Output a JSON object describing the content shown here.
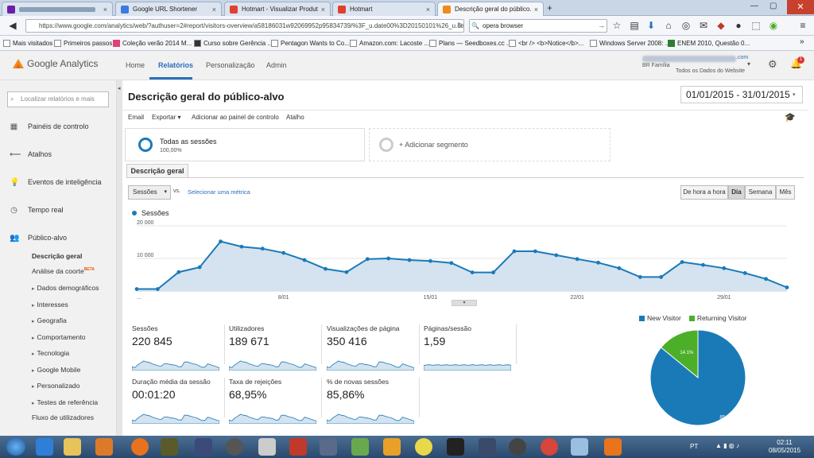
{
  "browser": {
    "tabs": [
      {
        "label": "",
        "fav_color": "#6b1fa8",
        "active": false
      },
      {
        "label": "Google URL Shortener",
        "fav_color": "#3b7be0",
        "active": false
      },
      {
        "label": "Hotmart - Visualizar Produto",
        "fav_color": "#e0402d",
        "active": false
      },
      {
        "label": "Hotmart",
        "fav_color": "#e0402d",
        "active": false
      },
      {
        "label": "Descrição geral do público...",
        "fav_color": "#f08a1d",
        "active": true
      }
    ],
    "url": "https://www.google.com/analytics/web/?authuser=2#report/visitors-overview/a58186031w92069952p95834739/%3F_u.date00%3D20150101%26_u.date01%",
    "search": "opera browser",
    "bookmarks": [
      "Mais visitados",
      "Primeiros passos",
      "Coleção verão 2014 M...",
      "Curso sobre Gerência ...",
      "Pentagon Wants to Co...",
      "Amazon.com: Lacoste ...",
      "Plans — Seedboxes.cc ...",
      "<br /> <b>Notice</b>...",
      "Windows Server 2008: ...",
      "ENEM 2010, Questão 0..."
    ]
  },
  "ga": {
    "logo": "Google Analytics",
    "nav": [
      "Home",
      "Relatórios",
      "Personalização",
      "Admin"
    ],
    "account_email": ".com",
    "account_name": "BR Família",
    "account_view": "Todos os Dados do Website",
    "notif_count": "1"
  },
  "sidebar": {
    "search_placeholder": "Localizar relatórios e mais",
    "items": [
      "Painéis de controlo",
      "Atalhos",
      "Eventos de inteligência",
      "Tempo real",
      "Público-alvo"
    ],
    "subitems": [
      "Descrição geral",
      "Análise da coorte",
      "Dados demográficos",
      "Interesses",
      "Geografia",
      "Comportamento",
      "Tecnologia",
      "Google Mobile",
      "Personalizado",
      "Testes de referência",
      "Fluxo de utilizadores"
    ],
    "beta_label": "BETA"
  },
  "report": {
    "title": "Descrição geral do público-alvo",
    "date_range": "01/01/2015 - 31/01/2015",
    "toolbar": [
      "Email",
      "Exportar ▾",
      "Adicionar ao painel de controlo",
      "Atalho"
    ],
    "segment_name": "Todas as sessões",
    "segment_pct": "100,00%",
    "add_segment": "+ Adicionar segmento",
    "subtab": "Descrição geral",
    "metric_dropdown": "Sessões",
    "vs_label": "vs.",
    "select_metric": "Selecionar uma métrica",
    "granularity": [
      "De hora a hora",
      "Dia",
      "Semana",
      "Mês"
    ],
    "active_granularity": "Dia"
  },
  "chart_data": [
    {
      "type": "area",
      "series": [
        {
          "name": "Sessões",
          "values": [
            600,
            600,
            5800,
            7300,
            15200,
            13600,
            13000,
            11700,
            9500,
            6800,
            5800,
            9800,
            10000,
            9500,
            9200,
            8600,
            5700,
            5700,
            12200,
            12200,
            11000,
            9800,
            8700,
            7000,
            4300,
            4300,
            8900,
            8000,
            7000,
            5500,
            3700,
            1100
          ]
        },
        {
          "name": "",
          "values": []
        }
      ],
      "x": [
        "1/01",
        "2/01",
        "3/01",
        "4/01",
        "5/01",
        "6/01",
        "7/01",
        "8/01",
        "9/01",
        "10/01",
        "11/01",
        "12/01",
        "13/01",
        "14/01",
        "15/01",
        "16/01",
        "17/01",
        "18/01",
        "19/01",
        "20/01",
        "21/01",
        "22/01",
        "23/01",
        "24/01",
        "25/01",
        "26/01",
        "27/01",
        "28/01",
        "29/01",
        "30/01",
        "31/01"
      ],
      "x_tick_labels": [
        "...",
        "8/01",
        "15/01",
        "22/01",
        "29/01"
      ],
      "y_tick_labels": [
        "20 000",
        "10 000"
      ],
      "ylim": [
        0,
        20000
      ],
      "color": "#1a7ab8"
    },
    {
      "type": "pie",
      "categories": [
        "New Visitor",
        "Returning Visitor"
      ],
      "values": [
        85.9,
        14.1
      ],
      "labels": [
        "85.9%",
        "14.1%"
      ],
      "colors": [
        "#1a7ab8",
        "#4caf2a"
      ]
    }
  ],
  "metrics": [
    {
      "label": "Sessões",
      "value": "220 845"
    },
    {
      "label": "Utilizadores",
      "value": "189 671"
    },
    {
      "label": "Visualizações de página",
      "value": "350 416"
    },
    {
      "label": "Páginas/sessão",
      "value": "1,59"
    },
    {
      "label": "Duração média da sessão",
      "value": "00:01:20"
    },
    {
      "label": "Taxa de rejeições",
      "value": "68,95%"
    },
    {
      "label": "% de novas sessões",
      "value": "85,86%"
    }
  ],
  "taskbar": {
    "lang": "PT",
    "time": "02:11",
    "date": "08/05/2015"
  }
}
